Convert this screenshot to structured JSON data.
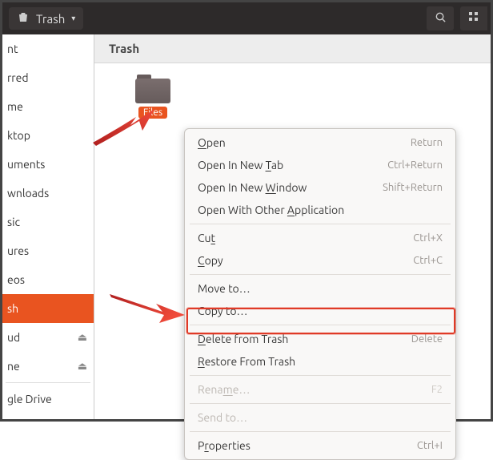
{
  "topbar": {
    "title": "Trash"
  },
  "pathbar": {
    "title": "Trash"
  },
  "sidebar": {
    "items": [
      {
        "label": "nt"
      },
      {
        "label": "rred"
      },
      {
        "label": "me"
      },
      {
        "label": "ktop"
      },
      {
        "label": "uments"
      },
      {
        "label": "wnloads"
      },
      {
        "label": "sic"
      },
      {
        "label": "ures"
      },
      {
        "label": "eos"
      },
      {
        "label": "sh"
      },
      {
        "label": "ud"
      },
      {
        "label": "ne"
      },
      {
        "label": "gle Drive"
      }
    ]
  },
  "folder": {
    "label": "Files"
  },
  "menu": {
    "open": "Open",
    "open_sc": "Return",
    "open_tab": "Open In New Tab",
    "open_tab_sc": "Ctrl+Return",
    "open_win": "Open In New Window",
    "open_win_sc": "Shift+Return",
    "open_other": "Open With Other Application",
    "cut": "Cut",
    "cut_sc": "Ctrl+X",
    "copy": "Copy",
    "copy_sc": "Ctrl+C",
    "move_to": "Move to…",
    "copy_to": "Copy to…",
    "delete": "Delete from Trash",
    "delete_sc": "Delete",
    "restore": "Restore From Trash",
    "rename": "Rename…",
    "rename_sc": "F2",
    "send_to": "Send to…",
    "properties": "Properties",
    "properties_sc": "Ctrl+I"
  }
}
